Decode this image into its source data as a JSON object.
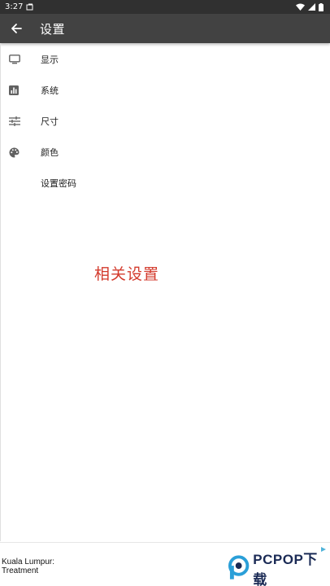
{
  "status_bar": {
    "time": "3:27",
    "icons": [
      "notification-icon",
      "wifi-icon",
      "signal-icon",
      "battery-icon"
    ]
  },
  "app_bar": {
    "title": "设置",
    "back_icon": "arrow-left-icon"
  },
  "menu": {
    "items": [
      {
        "label": "显示",
        "icon": "monitor-icon"
      },
      {
        "label": "系统",
        "icon": "bar-chart-icon"
      },
      {
        "label": "尺寸",
        "icon": "sliders-icon"
      },
      {
        "label": "颜色",
        "icon": "palette-icon"
      },
      {
        "label": "设置密码",
        "icon": ""
      }
    ]
  },
  "caption": "相关设置",
  "ad": {
    "text": "Kuala Lumpur: Treatment"
  },
  "watermark": {
    "text": "PCPOP下载"
  },
  "colors": {
    "status_bar": "#303030",
    "app_bar": "#424242",
    "caption": "#d33a2c",
    "icon": "#616161"
  }
}
